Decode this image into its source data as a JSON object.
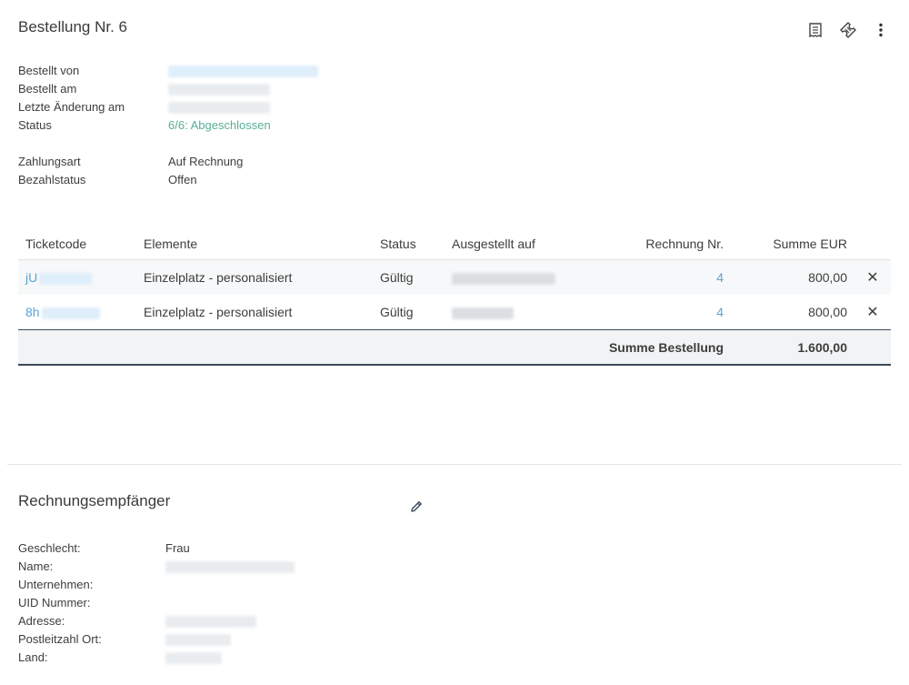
{
  "order": {
    "title": "Bestellung Nr. 6",
    "fields": {
      "ordered_by_label": "Bestellt von",
      "ordered_at_label": "Bestellt am",
      "last_change_label": "Letzte Änderung am",
      "status_label": "Status",
      "status_value": "6/6: Abgeschlossen",
      "payment_method_label": "Zahlungsart",
      "payment_method_value": "Auf Rechnung",
      "payment_status_label": "Bezahlstatus",
      "payment_status_value": "Offen"
    },
    "toolbar": {
      "icons": [
        "receipt-icon",
        "ticket-icon",
        "more-vertical-icon"
      ]
    }
  },
  "tickets": {
    "headers": {
      "ticketcode": "Ticketcode",
      "elemente": "Elemente",
      "status": "Status",
      "issued_to": "Ausgestellt auf",
      "invoice_nr": "Rechnung Nr.",
      "sum": "Summe EUR"
    },
    "rows": [
      {
        "code": "jU",
        "element": "Einzelplatz - personalisiert",
        "status": "Gültig",
        "invoice": "4",
        "sum": "800,00",
        "delete": "✕"
      },
      {
        "code": "8h",
        "element": "Einzelplatz - personalisiert",
        "status": "Gültig",
        "invoice": "4",
        "sum": "800,00",
        "delete": "✕"
      }
    ],
    "total_label": "Summe Bestellung",
    "total_value": "1.600,00"
  },
  "recipient": {
    "title": "Rechnungsempfänger",
    "fields": {
      "gender_label": "Geschlecht:",
      "gender_value": "Frau",
      "name_label": "Name:",
      "company_label": "Unternehmen:",
      "uid_label": "UID Nummer:",
      "address_label": "Adresse:",
      "zip_city_label": "Postleitzahl Ort:",
      "country_label": "Land:"
    }
  },
  "colors": {
    "status_green": "#5aaf98",
    "link_blue": "#5ba3d6",
    "delete_red": "#d9534f",
    "total_border": "#3b4a5a"
  }
}
